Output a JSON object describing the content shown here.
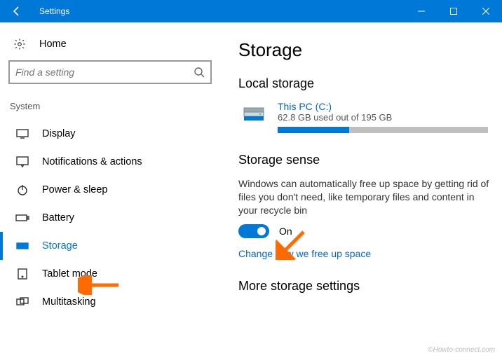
{
  "window": {
    "title": "Settings"
  },
  "sidebar": {
    "home_label": "Home",
    "search_placeholder": "Find a setting",
    "section_label": "System",
    "items": [
      {
        "label": "Display"
      },
      {
        "label": "Notifications & actions"
      },
      {
        "label": "Power & sleep"
      },
      {
        "label": "Battery"
      },
      {
        "label": "Storage"
      },
      {
        "label": "Tablet mode"
      },
      {
        "label": "Multitasking"
      }
    ]
  },
  "main": {
    "title": "Storage",
    "local_storage": {
      "heading": "Local storage",
      "drive_name": "This PC (C:)",
      "drive_usage": "62.8 GB used out of 195 GB",
      "used_gb": 62.8,
      "total_gb": 195
    },
    "storage_sense": {
      "heading": "Storage sense",
      "description": "Windows can automatically free up space by getting rid of files you don't need, like temporary files and content in your recycle bin",
      "toggle_state": "On",
      "toggle_on": true,
      "link": "Change how we free up space"
    },
    "more": {
      "heading": "More storage settings"
    }
  },
  "watermark": "©Howto-connect.com",
  "colors": {
    "accent": "#0078d7",
    "link": "#0066cc"
  }
}
